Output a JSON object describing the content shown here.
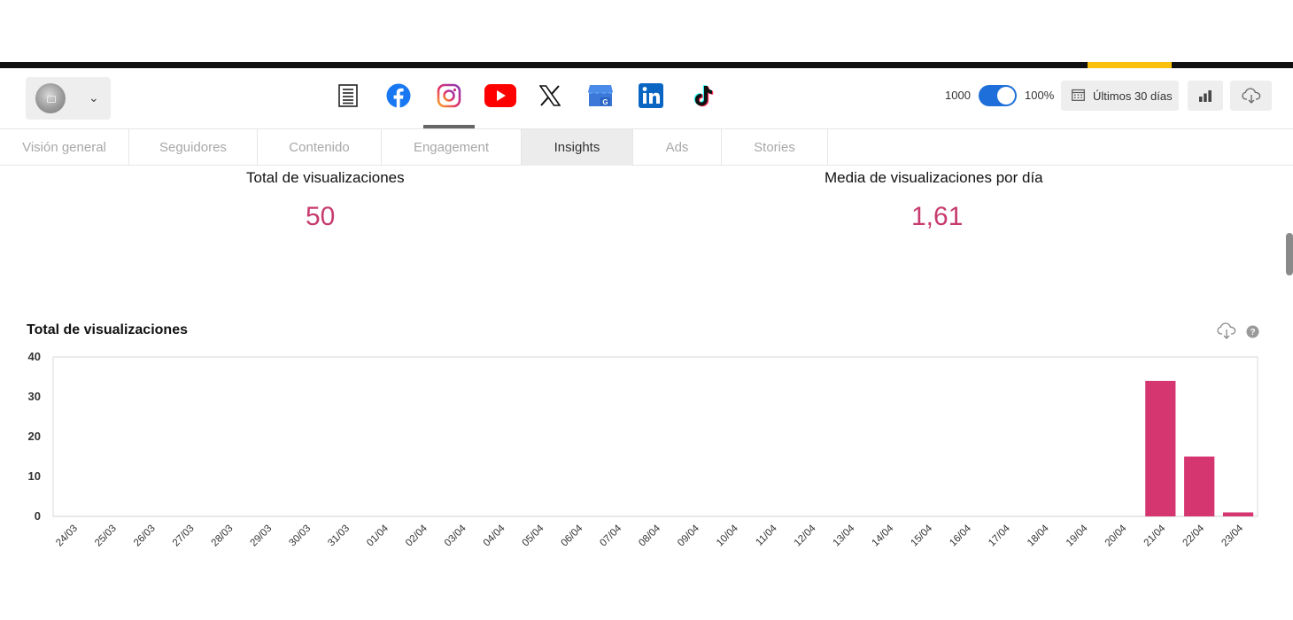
{
  "header": {
    "account": {
      "avatar": "avatar-image",
      "dropdown_icon": "chevron-down-icon"
    },
    "networks": [
      {
        "name": "document-icon"
      },
      {
        "name": "facebook-icon",
        "color": "#1877f2"
      },
      {
        "name": "instagram-icon",
        "active": true
      },
      {
        "name": "youtube-icon",
        "color": "#ff0000"
      },
      {
        "name": "x-icon",
        "color": "#111111"
      },
      {
        "name": "google-business-icon",
        "color": "#4285f4"
      },
      {
        "name": "linkedin-icon",
        "color": "#0a66c2"
      },
      {
        "name": "tiktok-icon",
        "color": "#111111"
      }
    ],
    "toggle_left_label": "1000",
    "toggle_right_label": "100%",
    "date_range_label": "Últimos 30 días",
    "toggle_on": true
  },
  "tabs": [
    {
      "label": "Visión general"
    },
    {
      "label": "Seguidores"
    },
    {
      "label": "Contenido"
    },
    {
      "label": "Engagement"
    },
    {
      "label": "Insights",
      "active": true
    },
    {
      "label": "Ads"
    },
    {
      "label": "Stories"
    }
  ],
  "kpis": [
    {
      "label": "Total de visualizaciones",
      "value": "50"
    },
    {
      "label": "Media de visualizaciones por día",
      "value": "1,61"
    }
  ],
  "accent_color": "#d63670",
  "chart_data": {
    "type": "bar",
    "title": "Total de visualizaciones",
    "categories": [
      "24/03",
      "25/03",
      "26/03",
      "27/03",
      "28/03",
      "29/03",
      "30/03",
      "31/03",
      "01/04",
      "02/04",
      "03/04",
      "04/04",
      "05/04",
      "06/04",
      "07/04",
      "08/04",
      "09/04",
      "10/04",
      "11/04",
      "12/04",
      "13/04",
      "14/04",
      "15/04",
      "16/04",
      "17/04",
      "18/04",
      "19/04",
      "20/04",
      "21/04",
      "22/04",
      "23/04"
    ],
    "values": [
      0,
      0,
      0,
      0,
      0,
      0,
      0,
      0,
      0,
      0,
      0,
      0,
      0,
      0,
      0,
      0,
      0,
      0,
      0,
      0,
      0,
      0,
      0,
      0,
      0,
      0,
      0,
      0,
      34,
      15,
      1
    ],
    "ylim": [
      0,
      40
    ],
    "yticks": [
      0,
      10,
      20,
      30,
      40
    ],
    "grid": false
  }
}
